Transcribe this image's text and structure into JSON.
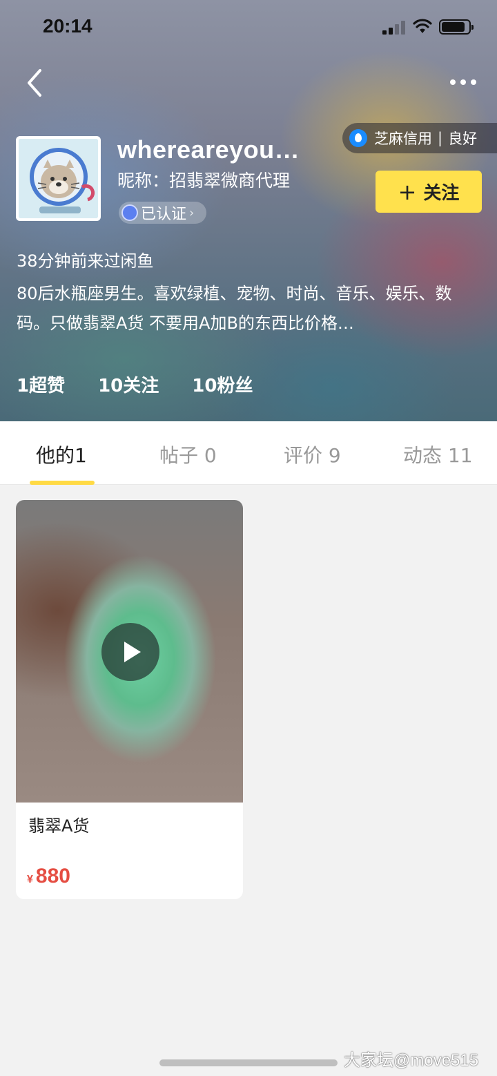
{
  "status_bar": {
    "time": "20:14"
  },
  "profile": {
    "username": "whereareyou…",
    "nickname": "昵称：招翡翠微商代理",
    "verified_label": "已认证",
    "follow_label": "关注",
    "credit": {
      "name": "芝麻信用",
      "rating": "良好"
    },
    "last_seen": "38分钟前来过闲鱼",
    "bio": "80后水瓶座男生。喜欢绿植、宠物、时尚、音乐、娱乐、数码。只做翡翠A货   不要用A加B的东西比价格…",
    "stats": [
      {
        "label": "1超赞"
      },
      {
        "label": "10关注"
      },
      {
        "label": "10粉丝"
      }
    ]
  },
  "tabs": [
    {
      "label": "他的1",
      "active": true
    },
    {
      "label": "帖子 0"
    },
    {
      "label": "评价 9"
    },
    {
      "label": "动态 11"
    }
  ],
  "items": [
    {
      "title": "翡翠A货",
      "currency": "¥",
      "price": "880",
      "has_video": true
    }
  ],
  "watermark": "大家坛@move515"
}
